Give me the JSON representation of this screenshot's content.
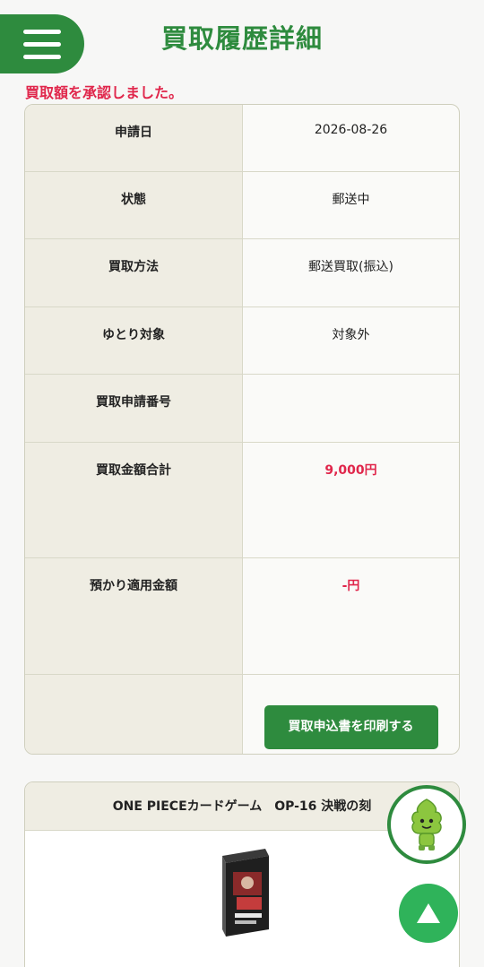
{
  "header": {
    "menu_label": "",
    "title": "買取履歴詳細"
  },
  "notice": "買取額を承認しました。",
  "details": {
    "application_date_label": "申請日",
    "application_date_value": "2026-08-26",
    "status_label": "状態",
    "status_value": "郵送中",
    "method_label": "買取方法",
    "method_value": "郵送買取(振込)",
    "yutori_label": "ゆとり対象",
    "yutori_value": "対象外",
    "application_no_label": "買取申請番号",
    "application_no_value": "",
    "total_label": "買取金額合計",
    "total_value": "9,000円",
    "deposit_label": "預かり適用金額",
    "deposit_value": "-円",
    "print_button": "買取申込書を印刷する"
  },
  "product": {
    "title": "ONE PIECEカードゲーム　OP-16 決戦の刻"
  },
  "floating": {
    "mascot_icon": "mascot-icon",
    "top_icon": "arrow-up-icon"
  },
  "colors": {
    "brand_green": "#2e8b3e",
    "accent_red": "#e0264b",
    "header_cell_bg": "#efede3"
  }
}
